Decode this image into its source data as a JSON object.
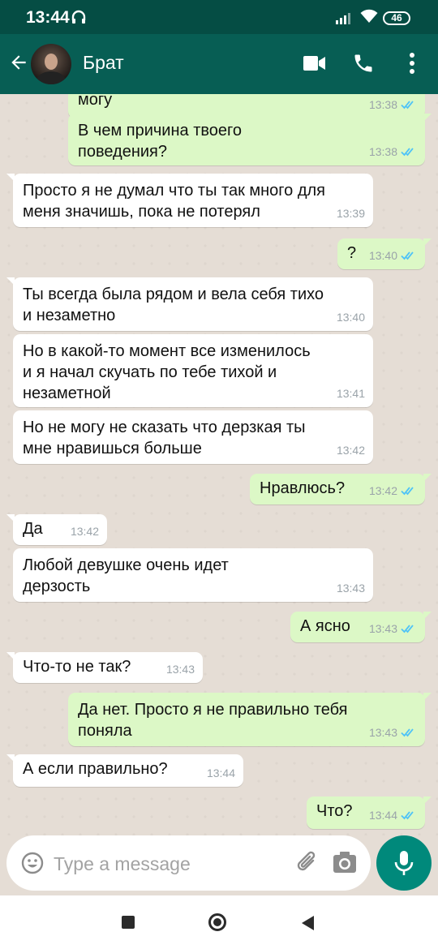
{
  "status_bar": {
    "time": "13:44",
    "battery": "46"
  },
  "header": {
    "contact_name": "Брат"
  },
  "messages": [
    {
      "dir": "out",
      "text": "могу",
      "time": "13:38",
      "read": true
    },
    {
      "dir": "out",
      "text": "В чем причина твоего\nповедения?",
      "time": "13:38",
      "read": true
    },
    {
      "dir": "in",
      "text": "Просто я не думал что ты так много для\nменя значишь, пока не потерял",
      "time": "13:39"
    },
    {
      "dir": "out",
      "text": "?",
      "time": "13:40",
      "read": true
    },
    {
      "dir": "in",
      "text": "Ты всегда была рядом и вела себя тихо\nи незаметно",
      "time": "13:40"
    },
    {
      "dir": "in",
      "text": "Но в какой-то момент все изменилось\nи я начал скучать по тебе тихой и\nнезаметной",
      "time": "13:41"
    },
    {
      "dir": "in",
      "text": "Но не могу не сказать что дерзкая ты\nмне нравишься больше",
      "time": "13:42"
    },
    {
      "dir": "out",
      "text": "Нравлюсь?",
      "time": "13:42",
      "read": true
    },
    {
      "dir": "in",
      "text": "Да",
      "time": "13:42"
    },
    {
      "dir": "in",
      "text": "Любой девушке очень идет\nдерзость",
      "time": "13:43"
    },
    {
      "dir": "out",
      "text": "А ясно",
      "time": "13:43",
      "read": true
    },
    {
      "dir": "in",
      "text": "Что-то не так?",
      "time": "13:43"
    },
    {
      "dir": "out",
      "text": "Да нет. Просто я не правильно тебя\nпоняла",
      "time": "13:43",
      "read": true
    },
    {
      "dir": "in",
      "text": "А если правильно?",
      "time": "13:44"
    },
    {
      "dir": "out",
      "text": "Что?",
      "time": "13:44",
      "read": true
    }
  ],
  "composer": {
    "placeholder": "Type a message"
  },
  "colors": {
    "header": "#075e54",
    "status_bar": "#054d44",
    "outgoing_bubble": "#dcf8c6",
    "incoming_bubble": "#ffffff",
    "read_ticks": "#4fc3f7",
    "fab": "#00897b"
  },
  "icons": [
    "back-arrow-icon",
    "video-call-icon",
    "phone-icon",
    "more-vert-icon",
    "emoji-icon",
    "attach-icon",
    "camera-icon",
    "mic-icon"
  ]
}
